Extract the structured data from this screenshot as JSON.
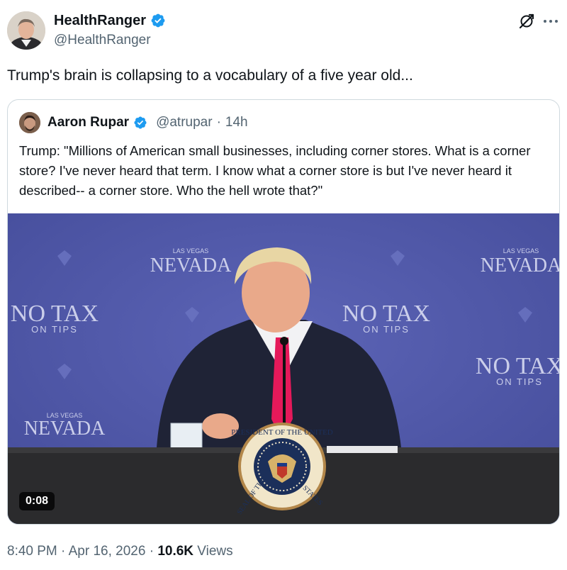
{
  "post": {
    "author_name": "HealthRanger",
    "author_handle": "@HealthRanger",
    "text": "Trump's brain is collapsing to a vocabulary of a five year old...",
    "icons": [
      "verified-badge-icon",
      "grok-icon",
      "more-icon"
    ]
  },
  "quoted_post": {
    "author_name": "Aaron Rupar",
    "author_handle": "@atrupar",
    "separator": "·",
    "age": "14h",
    "text": "Trump: \"Millions of American small businesses, including corner stores. What is a corner store? I've never heard that term. I know what a corner store is but I've never heard it described-- a corner store. Who the hell wrote that?\"",
    "video": {
      "duration": "0:08",
      "backdrop": {
        "las_vegas": "LAS VEGAS",
        "nevada": "NEVADA",
        "no_tax": "NO TAX",
        "on_tips": "ON TIPS"
      },
      "seal": {
        "top_text": "PRESIDENT OF THE UNITED",
        "left_text": "SEAL OF THE",
        "bottom_text": "STATES"
      }
    }
  },
  "meta": {
    "time": "8:40 PM",
    "dot1": "·",
    "date": "Apr 16, 2026",
    "dot2": "·",
    "views_count": "10.6K",
    "views_label": "Views"
  },
  "colors": {
    "verified": "#1d9bf0",
    "backdrop": "#5058a8",
    "text_primary": "#0f1419",
    "text_secondary": "#536471"
  }
}
